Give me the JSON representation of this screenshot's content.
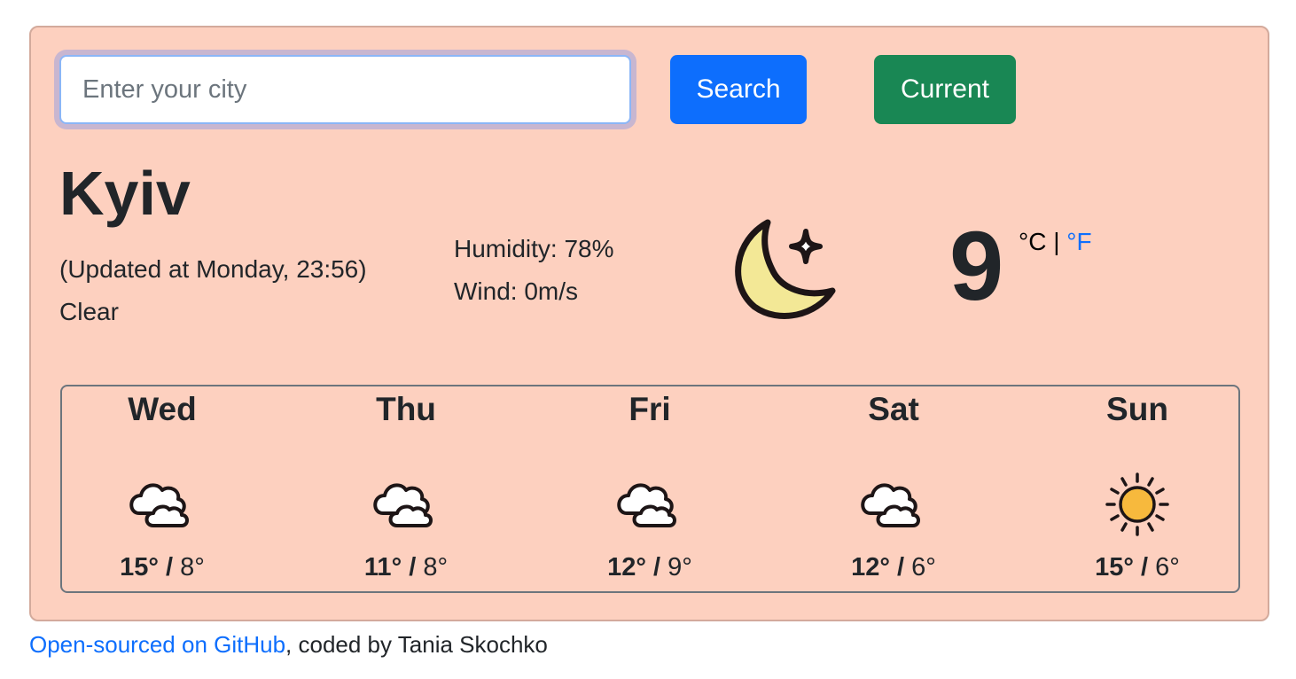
{
  "search": {
    "placeholder": "Enter your city",
    "value": "",
    "search_label": "Search",
    "current_label": "Current"
  },
  "colors": {
    "background": "#fdd0bf",
    "search_button": "#0d6efd",
    "current_button": "#198754",
    "link": "#0d6efd"
  },
  "current": {
    "city": "Kyiv",
    "updated": "(Updated at Monday, 23:56)",
    "description": "Clear",
    "humidity": "Humidity: 78%",
    "wind": "Wind: 0m/s",
    "icon": "moon-stars-icon",
    "temperature": "9",
    "unit_celsius": "°C",
    "unit_separator": "|",
    "unit_fahrenheit": "°F"
  },
  "forecast": [
    {
      "day": "Wed",
      "icon": "cloudy-icon",
      "max": "15°",
      "min": "8°"
    },
    {
      "day": "Thu",
      "icon": "cloudy-icon",
      "max": "11°",
      "min": "8°"
    },
    {
      "day": "Fri",
      "icon": "cloudy-icon",
      "max": "12°",
      "min": "9°"
    },
    {
      "day": "Sat",
      "icon": "cloudy-icon",
      "max": "12°",
      "min": "6°"
    },
    {
      "day": "Sun",
      "icon": "sun-icon",
      "max": "15°",
      "min": "6°"
    }
  ],
  "temp_separator": "/",
  "footer": {
    "link_text": "Open-sourced on GitHub",
    "suffix": ", coded by Tania Skochko"
  }
}
